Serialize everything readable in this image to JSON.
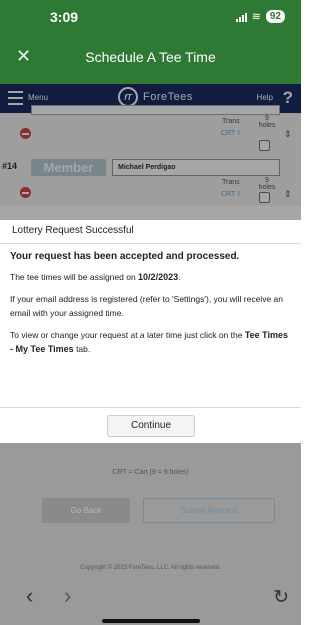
{
  "status_bar": {
    "time": "3:09",
    "battery": "92"
  },
  "header": {
    "title": "Schedule A Tee Time",
    "close_icon": "close-icon"
  },
  "app_nav": {
    "menu_label": "Menu",
    "logo_text": "ForeTees",
    "logo_badge": "fT",
    "help_label": "Help",
    "help_symbol": "?"
  },
  "rows": [
    {
      "trans": "Trans",
      "crt": "CRT ◊",
      "holes": "9 holes",
      "sort": "⇕"
    },
    {
      "number": "#14",
      "member_label": "Member",
      "name": "Michael Perdigao",
      "trans": "Trans",
      "crt": "CRT ◊",
      "holes": "9 holes",
      "sort": "⇕"
    }
  ],
  "modal": {
    "title": "Lottery Request Successful",
    "headline": "Your request has been accepted and processed.",
    "assign_prefix": "The tee times will be assigned on ",
    "assign_date": "10/2/2023",
    "assign_suffix": ".",
    "email_note": "If your email address is registered (refer to 'Settings'), you will receive an email with your assigned time.",
    "change_prefix": "To view or change your request at a later time just click on the ",
    "change_tab": "Tee Times - My Tee Times",
    "change_suffix": " tab.",
    "continue_label": "Continue"
  },
  "lower": {
    "legend": "CRT = Cart  (9 = 9 holes)",
    "go_back_label": "Go Back",
    "submit_label": "Submit Request",
    "copyright": "Copyright © 2023 ForeTees, LLC. All rights reserved."
  },
  "browser": {
    "back": "‹",
    "forward": "›",
    "reload": "↻"
  },
  "colors": {
    "header_green": "#2e7a34",
    "nav_navy": "#1d2b63",
    "delete_red": "#d84545"
  }
}
